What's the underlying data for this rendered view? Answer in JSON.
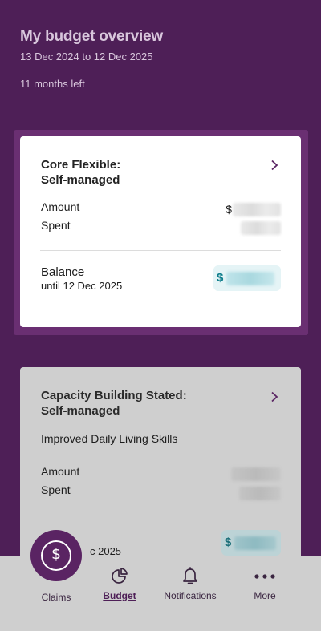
{
  "header": {
    "title": "My budget overview",
    "date_range": "13 Dec 2024 to 12 Dec 2025",
    "months_left": "11 months left"
  },
  "cards": [
    {
      "title_line1": "Core Flexible:",
      "title_line2": "Self-managed",
      "amount_label": "Amount",
      "amount_currency": "$",
      "spent_label": "Spent",
      "balance_label": "Balance",
      "balance_sub": "until 12 Dec 2025",
      "balance_currency": "$"
    },
    {
      "title_line1": "Capacity Building Stated:",
      "title_line2": "Self-managed",
      "subtitle": "Improved Daily Living Skills",
      "amount_label": "Amount",
      "spent_label": "Spent",
      "balance_sub_partial": "c 2025",
      "balance_currency": "$"
    }
  ],
  "nav": {
    "claims": "Claims",
    "budget": "Budget",
    "notifications": "Notifications",
    "more": "More",
    "active": "Budget"
  },
  "colors": {
    "background": "#4e1f57",
    "accent": "#0f7e8c"
  }
}
